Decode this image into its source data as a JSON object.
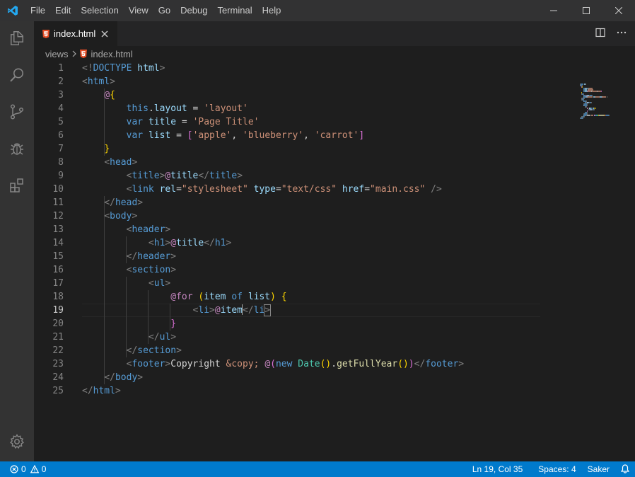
{
  "window": {
    "menu": [
      "File",
      "Edit",
      "Selection",
      "View",
      "Go",
      "Debug",
      "Terminal",
      "Help"
    ]
  },
  "tabs": [
    {
      "label": "index.html",
      "icon": "html5-file-icon",
      "active": true
    }
  ],
  "breadcrumb": {
    "folder": "views",
    "file": "index.html"
  },
  "editor": {
    "line_numbers": [
      "1",
      "2",
      "3",
      "4",
      "5",
      "6",
      "7",
      "8",
      "9",
      "10",
      "11",
      "12",
      "13",
      "14",
      "15",
      "16",
      "17",
      "18",
      "19",
      "20",
      "21",
      "22",
      "23",
      "24",
      "25"
    ],
    "active_line": 19
  },
  "status": {
    "errors": "0",
    "warnings": "0",
    "cursor_position": "Ln 19, Col 35",
    "indentation": "Spaces: 4",
    "user": "Saker"
  },
  "colors": {
    "accent": "#007acc",
    "activity_bar": "#333333",
    "editor_bg": "#1e1e1e"
  }
}
